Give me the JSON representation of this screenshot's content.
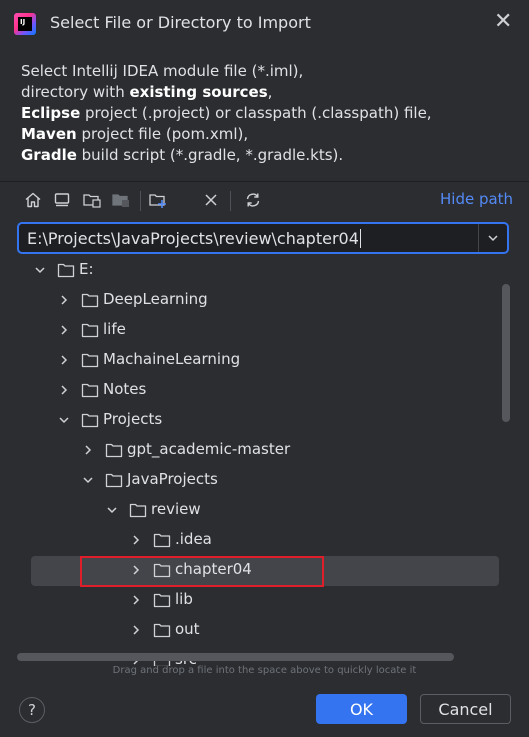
{
  "dialog": {
    "title": "Select File or Directory to Import",
    "description": [
      {
        "parts": [
          {
            "t": "Select Intellij IDEA module file (*.iml),",
            "b": false
          }
        ]
      },
      {
        "parts": [
          {
            "t": "directory with ",
            "b": false
          },
          {
            "t": "existing sources",
            "b": true
          },
          {
            "t": ",",
            "b": false
          }
        ]
      },
      {
        "parts": [
          {
            "t": "Eclipse",
            "b": true
          },
          {
            "t": " project (.project) or classpath (.classpath) file,",
            "b": false
          }
        ]
      },
      {
        "parts": [
          {
            "t": "Maven",
            "b": true
          },
          {
            "t": " project file (pom.xml),",
            "b": false
          }
        ]
      },
      {
        "parts": [
          {
            "t": "Gradle",
            "b": true
          },
          {
            "t": " build script (*.gradle, *.gradle.kts).",
            "b": false
          }
        ]
      }
    ]
  },
  "toolbar": {
    "icons": [
      "home-icon",
      "desktop-icon",
      "project-folder-icon",
      "module-folder-icon",
      "new-folder-icon",
      "delete-icon",
      "refresh-icon"
    ],
    "hide_path_label": "Hide path"
  },
  "path": {
    "value": "E:\\Projects\\JavaProjects\\review\\chapter04"
  },
  "tree": {
    "rows": [
      {
        "label": "E:",
        "level": 0,
        "expanded": true
      },
      {
        "label": "DeepLearning",
        "level": 1,
        "expanded": false
      },
      {
        "label": "life",
        "level": 1,
        "expanded": false
      },
      {
        "label": "MachaineLearning",
        "level": 1,
        "expanded": false
      },
      {
        "label": "Notes",
        "level": 1,
        "expanded": false
      },
      {
        "label": "Projects",
        "level": 1,
        "expanded": true
      },
      {
        "label": "gpt_academic-master",
        "level": 2,
        "expanded": false
      },
      {
        "label": "JavaProjects",
        "level": 2,
        "expanded": true
      },
      {
        "label": "review",
        "level": 3,
        "expanded": true
      },
      {
        "label": ".idea",
        "level": 4,
        "expanded": false
      },
      {
        "label": "chapter04",
        "level": 4,
        "expanded": false,
        "selected": true
      },
      {
        "label": "lib",
        "level": 4,
        "expanded": false
      },
      {
        "label": "out",
        "level": 4,
        "expanded": false
      },
      {
        "label": "src",
        "level": 4,
        "expanded": false
      }
    ]
  },
  "hint": "Drag and drop a file into the space above to quickly locate it",
  "buttons": {
    "help": "?",
    "ok": "OK",
    "cancel": "Cancel"
  },
  "colors": {
    "background": "#2b2d30",
    "accent": "#3574f0",
    "link": "#548af7",
    "selection": "#43454a",
    "highlight_box": "#e01e2a"
  }
}
